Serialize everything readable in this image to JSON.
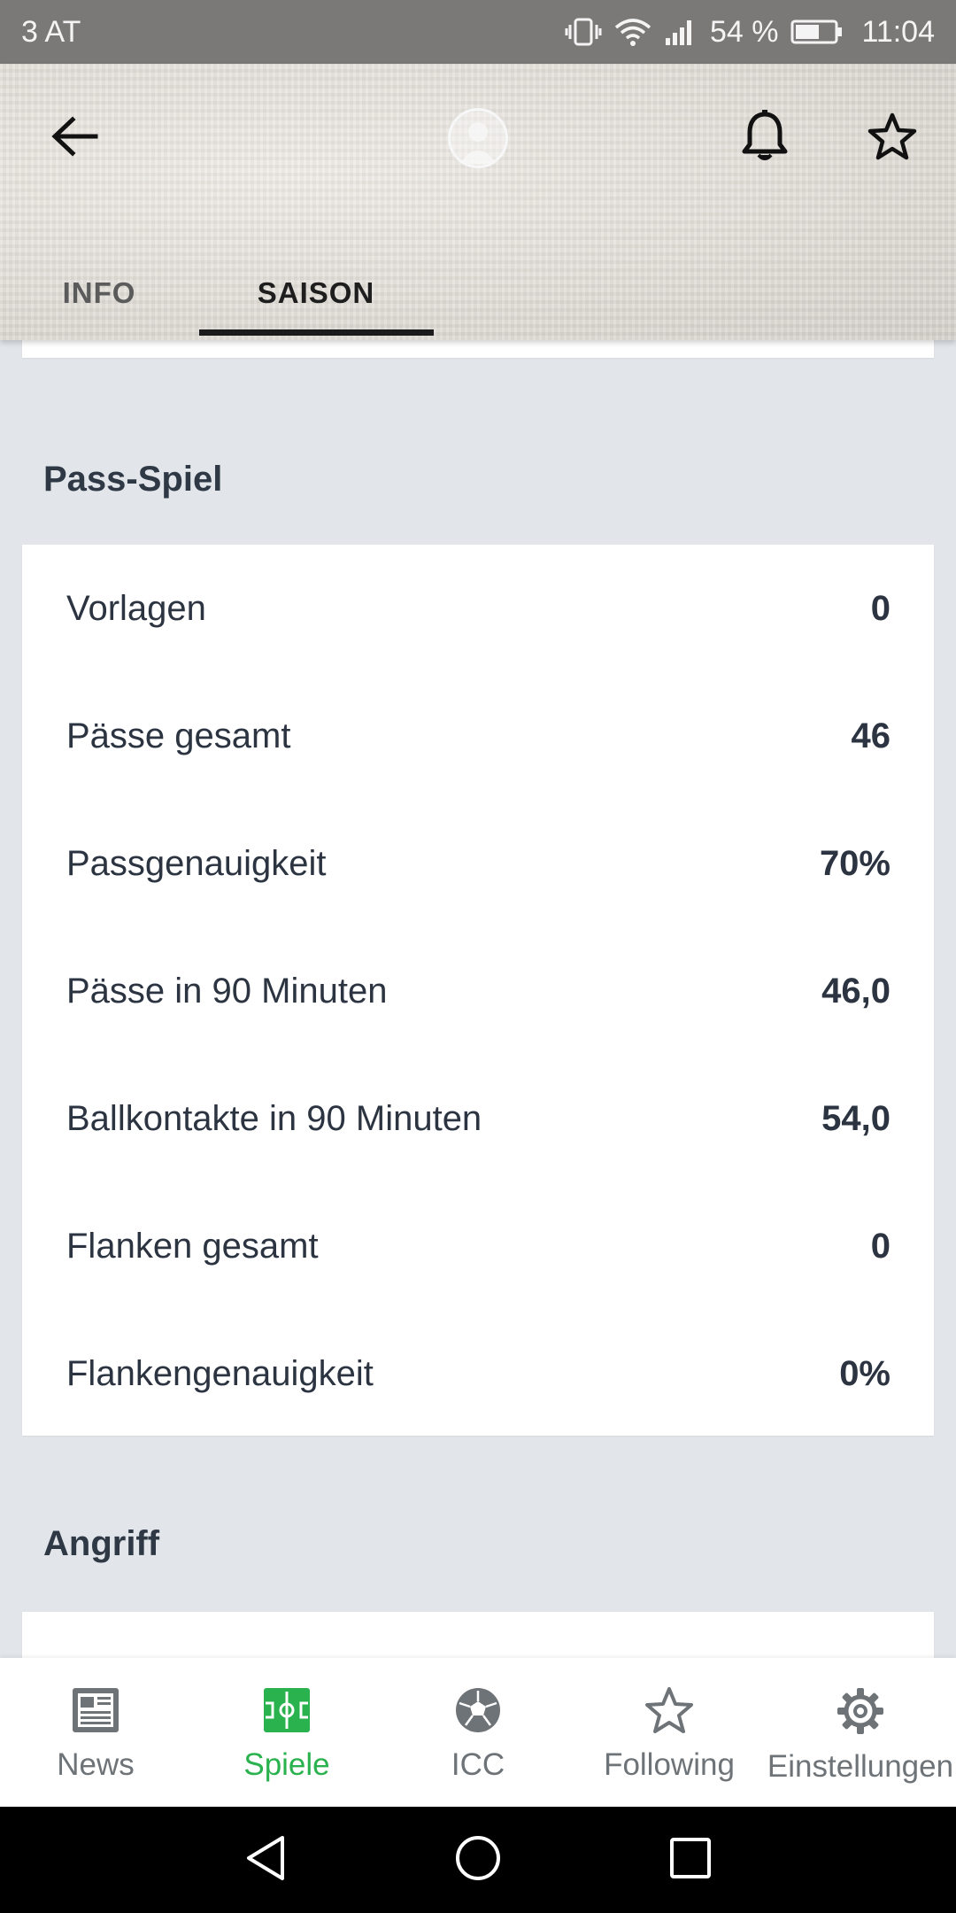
{
  "status_bar": {
    "carrier": "3 AT",
    "battery": "54 %",
    "time": "11:04"
  },
  "header": {
    "tabs": [
      {
        "label": "INFO",
        "active": false
      },
      {
        "label": "SAISON",
        "active": true
      }
    ]
  },
  "sections": {
    "pass": {
      "title": "Pass-Spiel",
      "rows": [
        {
          "label": "Vorlagen",
          "value": "0"
        },
        {
          "label": "Pässe gesamt",
          "value": "46"
        },
        {
          "label": "Passgenauigkeit",
          "value": "70%"
        },
        {
          "label": "Pässe in 90 Minuten",
          "value": "46,0"
        },
        {
          "label": "Ballkontakte in 90 Minuten",
          "value": "54,0"
        },
        {
          "label": "Flanken gesamt",
          "value": "0"
        },
        {
          "label": "Flankengenauigkeit",
          "value": "0%"
        }
      ]
    },
    "angriff": {
      "title": "Angriff"
    }
  },
  "bottom_nav": {
    "items": [
      {
        "label": "News",
        "icon": "newspaper-icon",
        "active": false
      },
      {
        "label": "Spiele",
        "icon": "pitch-icon",
        "active": true
      },
      {
        "label": "ICC",
        "icon": "football-icon",
        "active": false
      },
      {
        "label": "Following",
        "icon": "star-icon",
        "active": false
      },
      {
        "label": "Einstellungen",
        "icon": "gear-icon",
        "active": false
      }
    ]
  },
  "colors": {
    "accent": "#2ab24e",
    "background": "#e2e6ea",
    "card": "#ffffff",
    "text": "#2b3440"
  }
}
